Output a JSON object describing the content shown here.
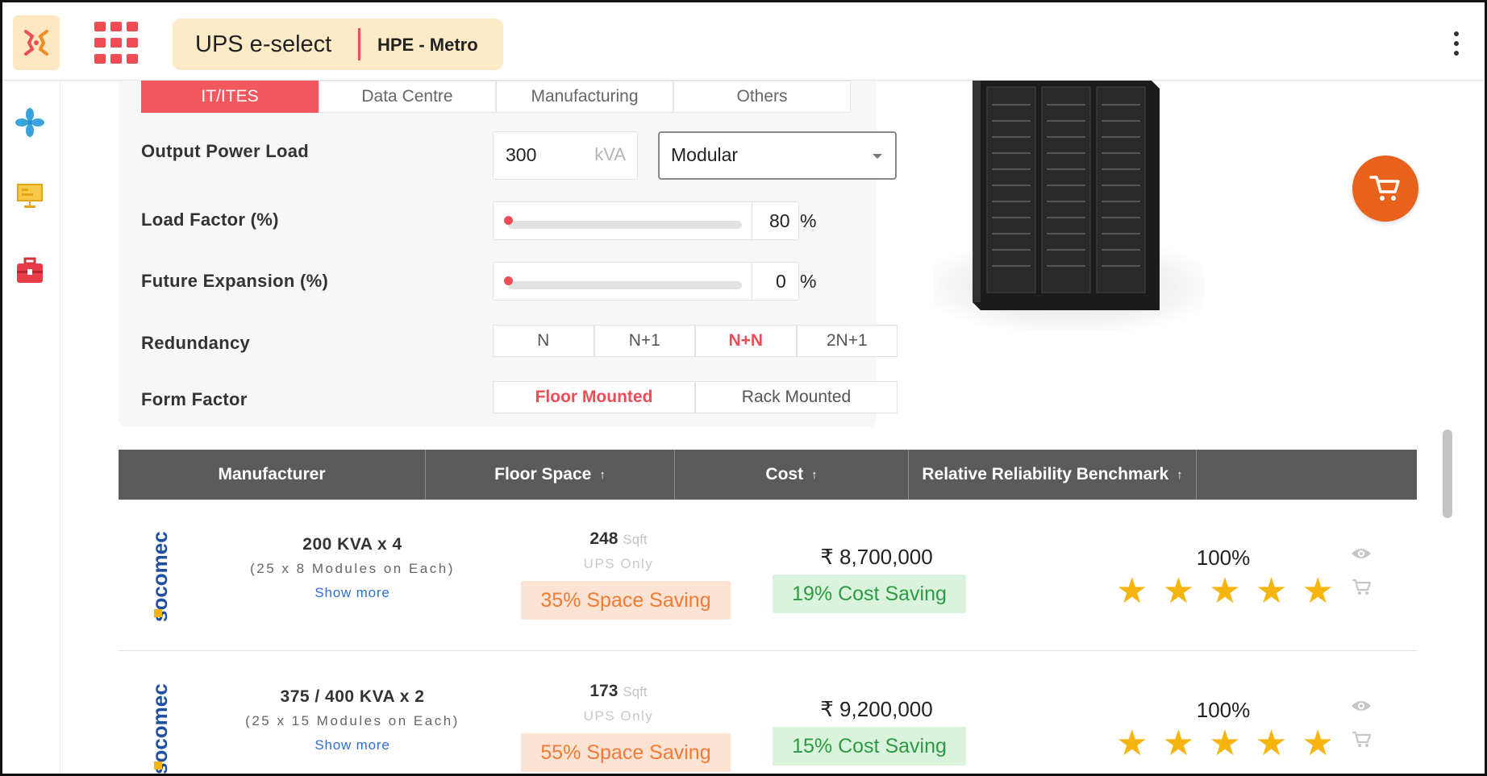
{
  "header": {
    "app_title": "UPS e-select",
    "context": "HPE - Metro"
  },
  "sidebar": {
    "items": [
      {
        "icon": "fan-icon"
      },
      {
        "icon": "presentation-board-icon"
      },
      {
        "icon": "toolbox-icon"
      }
    ]
  },
  "segments": {
    "tabs": [
      "IT/ITES",
      "Data Centre",
      "Manufacturing",
      "Others"
    ],
    "active": "IT/ITES"
  },
  "form": {
    "output_power_load": {
      "label": "Output Power Load",
      "value": "300",
      "unit": "kVA",
      "type_selected": "Modular"
    },
    "load_factor": {
      "label": "Load Factor (%)",
      "value": "80",
      "unit": "%",
      "level_percent": 0
    },
    "future_expansion": {
      "label": "Future Expansion (%)",
      "value": "0",
      "unit": "%",
      "level_percent": 0
    },
    "redundancy": {
      "label": "Redundancy",
      "options": [
        "N",
        "N+1",
        "N+N",
        "2N+1"
      ],
      "selected": "N+N"
    },
    "form_factor": {
      "label": "Form Factor",
      "options": [
        "Floor Mounted",
        "Rack Mounted"
      ],
      "selected": "Floor Mounted"
    }
  },
  "colors": {
    "accent": "#ef4c55",
    "cart": "#e8621c",
    "space_saving": "#f07b35",
    "cost_saving": "#2e9a43",
    "star": "#f6b40e"
  },
  "table": {
    "columns": [
      {
        "label": "Manufacturer",
        "sortable": false
      },
      {
        "label": "Floor Space",
        "sortable": true
      },
      {
        "label": "Cost",
        "sortable": true
      },
      {
        "label": "Relative Reliability Benchmark",
        "sortable": true
      }
    ],
    "sort_arrow": "↑",
    "rows": [
      {
        "manufacturer_logo": "socomec",
        "config": "200 KVA x 4",
        "modules": "(25 x 8 Modules on Each)",
        "show_more": "Show more",
        "floor_space": "248",
        "floor_unit": "Sqft",
        "floor_note": "UPS Only",
        "space_saving": "35% Space Saving",
        "cost": "₹ 8,700,000",
        "cost_saving": "19% Cost Saving",
        "reliability": "100%",
        "stars": 5
      },
      {
        "manufacturer_logo": "socomec",
        "config": "375 / 400 KVA x 2",
        "modules": "(25 x 15 Modules on Each)",
        "show_more": "Show more",
        "floor_space": "173",
        "floor_unit": "Sqft",
        "floor_note": "UPS Only",
        "space_saving": "55% Space Saving",
        "cost": "₹ 9,200,000",
        "cost_saving": "15% Cost Saving",
        "reliability": "100%",
        "stars": 5
      }
    ]
  }
}
